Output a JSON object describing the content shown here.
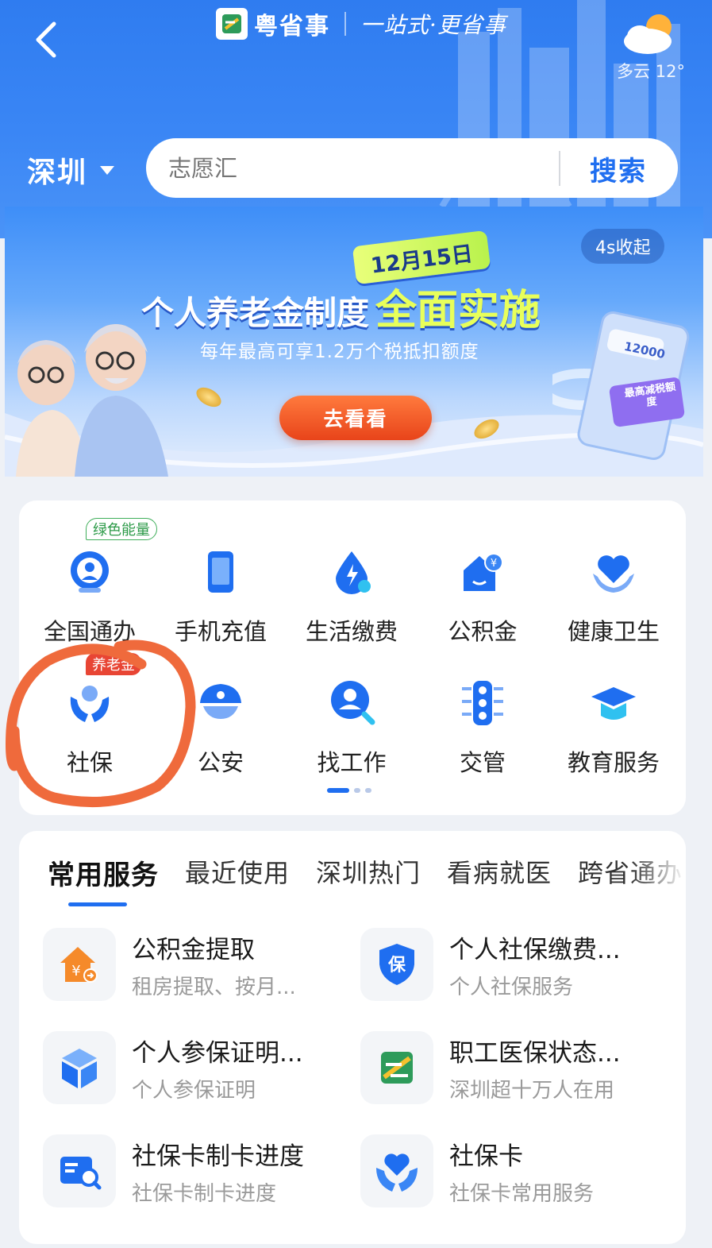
{
  "header": {
    "back_icon": "chevron-left-icon",
    "brand_name": "粤省事",
    "brand_slogan": "一站式·更省事",
    "weather": {
      "icon": "partly-cloudy-icon",
      "text": "多云 12°"
    },
    "city": "深圳",
    "search": {
      "placeholder": "志愿汇",
      "button": "搜索"
    }
  },
  "banner": {
    "collapse_label": "4s收起",
    "date_tag": "12月15日",
    "title_main": "个人养老金制度",
    "title_highlight": "全面实施",
    "subtitle": "每年最高可享1.2万个税抵扣额度",
    "cta": "去看看",
    "device_amount": "12000",
    "device_note": "最高减税额度"
  },
  "grid": {
    "items": [
      {
        "label": "全国通办",
        "icon": "globe-icon",
        "badge": "绿色能量"
      },
      {
        "label": "手机充值",
        "icon": "phone-icon",
        "badge": ""
      },
      {
        "label": "生活缴费",
        "icon": "utility-drop-icon",
        "badge": ""
      },
      {
        "label": "公积金",
        "icon": "housing-fund-icon",
        "badge": ""
      },
      {
        "label": "健康卫生",
        "icon": "heart-hands-icon",
        "badge": ""
      },
      {
        "label": "社保",
        "icon": "social-security-icon",
        "badge": "养老金"
      },
      {
        "label": "公安",
        "icon": "police-cap-icon",
        "badge": ""
      },
      {
        "label": "找工作",
        "icon": "job-search-icon",
        "badge": ""
      },
      {
        "label": "交管",
        "icon": "traffic-light-icon",
        "badge": ""
      },
      {
        "label": "教育服务",
        "icon": "graduation-cap-icon",
        "badge": ""
      }
    ],
    "page_count": 3,
    "current_page": 1
  },
  "services": {
    "tabs": [
      "常用服务",
      "最近使用",
      "深圳热门",
      "看病就医",
      "跨省通办"
    ],
    "active_tab": 0,
    "items": [
      {
        "title": "公积金提取",
        "subtitle": "租房提取、按月...",
        "icon": "house-yuan-icon"
      },
      {
        "title": "个人社保缴费...",
        "subtitle": "个人社保服务",
        "icon": "shield-bao-icon"
      },
      {
        "title": "个人参保证明...",
        "subtitle": "个人参保证明",
        "icon": "cube-icon"
      },
      {
        "title": "职工医保状态...",
        "subtitle": "深圳超十万人在用",
        "icon": "app-logo-icon"
      },
      {
        "title": "社保卡制卡进度",
        "subtitle": "社保卡制卡进度",
        "icon": "card-search-icon"
      },
      {
        "title": "社保卡",
        "subtitle": "社保卡常用服务",
        "icon": "heart-hands-icon"
      }
    ]
  },
  "colors": {
    "primary": "#1f6ef0",
    "header_bg": "#2f7cf0",
    "badge_red": "#e84534",
    "badge_green": "#3fae5a",
    "annotation": "#ef6a3c"
  }
}
